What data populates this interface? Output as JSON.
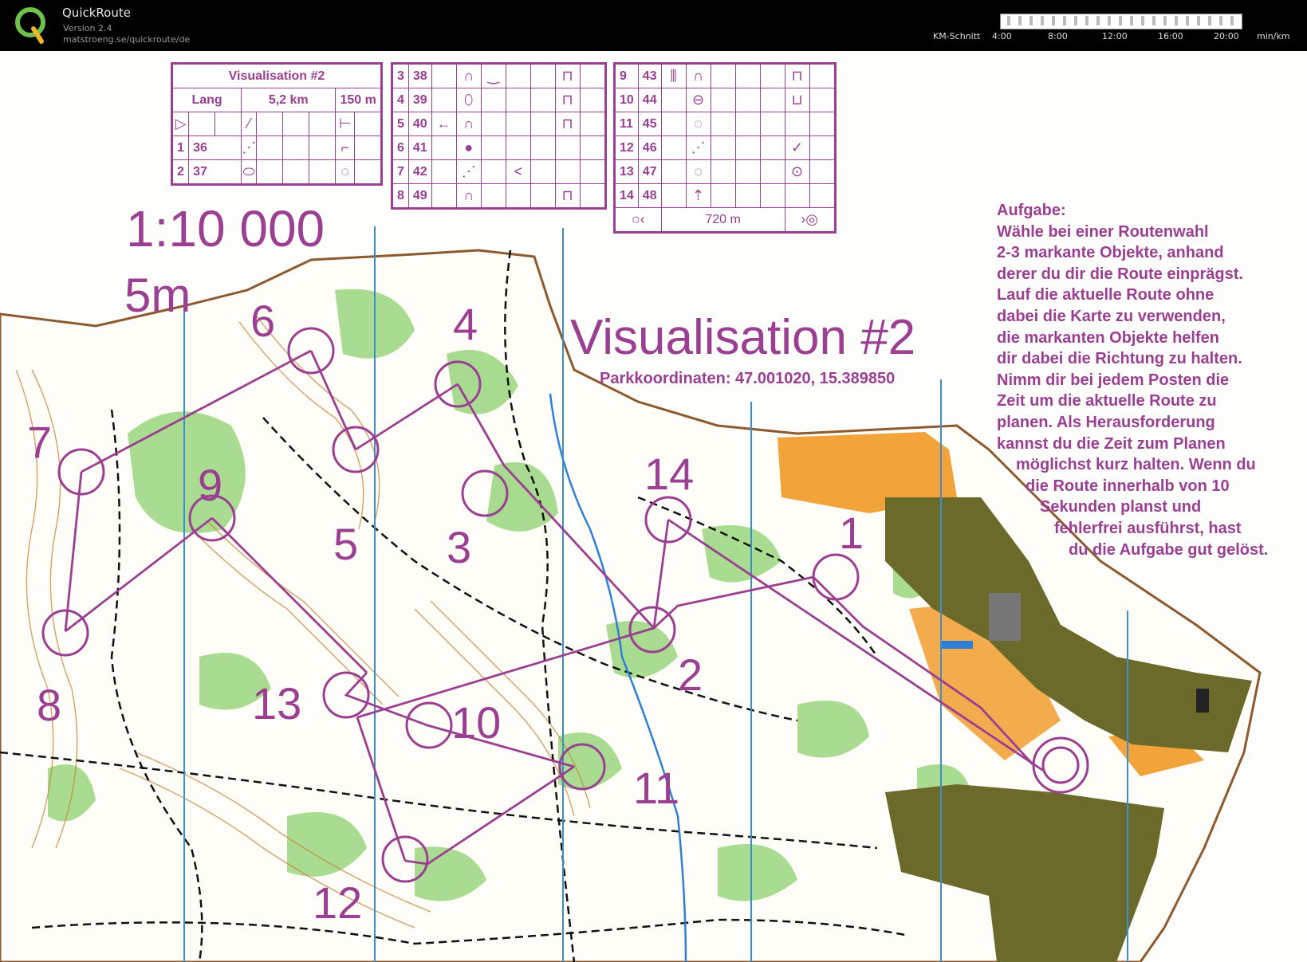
{
  "app": {
    "name": "QuickRoute",
    "version": "Version 2.4",
    "url": "matstroeng.se/quickroute/de"
  },
  "pace_scale": {
    "label": "KM-Schnitt",
    "ticks": [
      "4:00",
      "8:00",
      "12:00",
      "16:00",
      "20:00"
    ],
    "unit": "min/km"
  },
  "map": {
    "scale": "1:10 000",
    "contour": "5m",
    "title": "Visualisation #2",
    "coordinates": "Parkkoordinaten: 47.001020, 15.389850",
    "task_lines": [
      "Aufgabe:",
      "Wähle bei einer Routenwahl",
      "2-3 markante Objekte, anhand",
      "derer du dir die Route einprägst.",
      "Lauf die aktuelle Route ohne",
      "dabei die Karte zu verwenden,",
      "die markanten Objekte helfen",
      "dir dabei die Richtung zu halten.",
      "Nimm dir bei jedem Posten die",
      "Zeit um die aktuelle Route zu",
      "planen. Als Herausforderung",
      "kannst du die Zeit zum Planen",
      "möglichst kurz halten. Wenn du",
      "die Route innerhalb von 10",
      "Sekunden planst und",
      "fehlerfrei ausführst, hast",
      "du die Aufgabe gut gelöst."
    ],
    "control_labels": [
      "1",
      "2",
      "3",
      "4",
      "5",
      "6",
      "7",
      "8",
      "9",
      "10",
      "11",
      "12",
      "13",
      "14"
    ],
    "colors": {
      "course": "#9a3f92",
      "vegetation": "#8ccf6e",
      "open_land": "#f2a33a",
      "settlement": "#6b6a2a",
      "magnetic_north": "#3a8fd0",
      "contour": "#c8823a"
    }
  },
  "description_sheet": {
    "title": "Visualisation #2",
    "class": "Lang",
    "length": "5,2 km",
    "climb": "150 m",
    "rows_a": [
      {
        "num": "1",
        "code": "36"
      },
      {
        "num": "2",
        "code": "37"
      }
    ],
    "rows_b": [
      {
        "num": "3",
        "code": "38"
      },
      {
        "num": "4",
        "code": "39"
      },
      {
        "num": "5",
        "code": "40"
      },
      {
        "num": "6",
        "code": "41"
      },
      {
        "num": "7",
        "code": "42"
      },
      {
        "num": "8",
        "code": "49"
      }
    ],
    "rows_c": [
      {
        "num": "9",
        "code": "43"
      },
      {
        "num": "10",
        "code": "44"
      },
      {
        "num": "11",
        "code": "45"
      },
      {
        "num": "12",
        "code": "46"
      },
      {
        "num": "13",
        "code": "47"
      },
      {
        "num": "14",
        "code": "48"
      }
    ],
    "finish_distance": "720 m"
  }
}
